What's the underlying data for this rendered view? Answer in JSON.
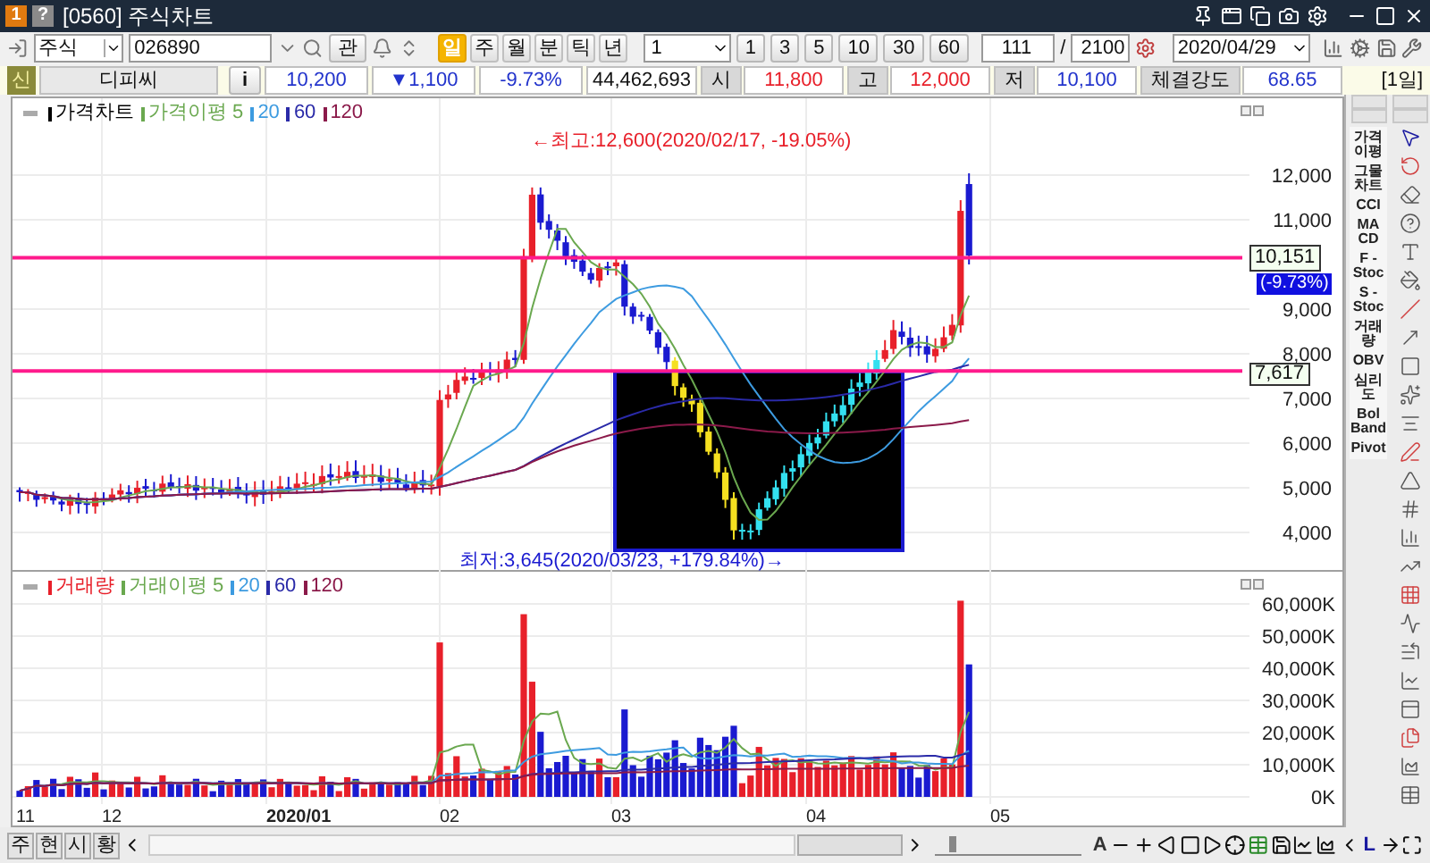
{
  "window": {
    "badge": "1",
    "help": "?",
    "title": "[0560] 주식차트"
  },
  "toolbar": {
    "market": "주식",
    "code": "026890",
    "watch_button": "관",
    "periods": [
      {
        "label": "일",
        "selected": true
      },
      {
        "label": "주",
        "selected": false
      },
      {
        "label": "월",
        "selected": false
      },
      {
        "label": "분",
        "selected": false
      },
      {
        "label": "틱",
        "selected": false
      },
      {
        "label": "년",
        "selected": false
      }
    ],
    "unit": "1",
    "counts": [
      "1",
      "3",
      "5",
      "10",
      "30",
      "60"
    ],
    "count": "111",
    "separator": "/",
    "total": "2100",
    "date": "2020/04/29"
  },
  "quote": {
    "badge": "신",
    "name": "디피씨",
    "info_button": "i",
    "price": "10,200",
    "change": "▼1,100",
    "rate": "-9.73%",
    "volume": "44,462,693",
    "fields": [
      {
        "label": "시",
        "value": "11,800",
        "color": "#e8202a"
      },
      {
        "label": "고",
        "value": "12,000",
        "color": "#e8202a"
      },
      {
        "label": "저",
        "value": "10,100",
        "color": "#2233cc"
      },
      {
        "label": "체결강도",
        "value": "68.65",
        "color": "#2233cc"
      }
    ],
    "period": "[1일]"
  },
  "price_pane": {
    "legend": [
      {
        "label": "가격차트",
        "color": "#000000"
      },
      {
        "label": "가격이평 5",
        "color": "#6aa84f"
      },
      {
        "label": "20",
        "color": "#3d9be0"
      },
      {
        "label": "60",
        "color": "#2a2aa8"
      },
      {
        "label": "120",
        "color": "#8b1a4a"
      }
    ],
    "yticks": [
      "12,000",
      "11,000",
      "9,000",
      "8,000",
      "7,000",
      "6,000",
      "5,000",
      "4,000"
    ],
    "high_note": "←최고:12,600(2020/02/17, -19.05%)",
    "low_note": "최저:3,645(2020/03/23, +179.84%)→",
    "price_lines": [
      "10,151",
      "7,617"
    ],
    "current_rate": "(-9.73%)"
  },
  "volume_pane": {
    "legend": [
      {
        "label": "거래량",
        "color": "#e8202a"
      },
      {
        "label": "거래이평 5",
        "color": "#6aa84f"
      },
      {
        "label": "20",
        "color": "#3d9be0"
      },
      {
        "label": "60",
        "color": "#2a2aa8"
      },
      {
        "label": "120",
        "color": "#8b1a4a"
      }
    ],
    "yticks": [
      "60,000K",
      "50,000K",
      "40,000K",
      "30,000K",
      "20,000K",
      "10,000K",
      "0K"
    ]
  },
  "x_axis": [
    {
      "label": "11",
      "bold": false
    },
    {
      "label": "12",
      "bold": false
    },
    {
      "label": "2020/01",
      "bold": true
    },
    {
      "label": "02",
      "bold": false
    },
    {
      "label": "03",
      "bold": false
    },
    {
      "label": "04",
      "bold": false
    },
    {
      "label": "05",
      "bold": false
    }
  ],
  "indicators": [
    {
      "lines": [
        "가격",
        "이평"
      ]
    },
    {
      "lines": [
        "그물",
        "차트"
      ]
    },
    {
      "lines": [
        "CCI"
      ]
    },
    {
      "lines": [
        "MA",
        "CD"
      ]
    },
    {
      "lines": [
        "F -",
        "Stoc"
      ]
    },
    {
      "lines": [
        "S -",
        "Stoc"
      ]
    },
    {
      "lines": [
        "거래",
        "량"
      ]
    },
    {
      "lines": [
        "OBV"
      ]
    },
    {
      "lines": [
        "심리",
        "도"
      ]
    },
    {
      "lines": [
        "Bol",
        "Band"
      ]
    },
    {
      "lines": [
        "Pivot"
      ]
    }
  ],
  "bottom_bar": {
    "tabs": [
      "주",
      "현",
      "시",
      "황"
    ],
    "tools": [
      "A",
      "L"
    ],
    "zoom": {
      "level": 0.1
    }
  }
}
